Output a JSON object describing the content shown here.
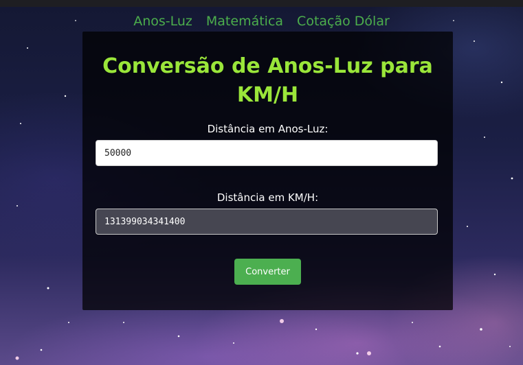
{
  "nav": {
    "items": [
      {
        "label": "Anos-Luz"
      },
      {
        "label": "Matemática"
      },
      {
        "label": "Cotação Dólar"
      }
    ]
  },
  "converter": {
    "title": "Conversão de Anos-Luz para KM/H",
    "input_label": "Distância em Anos-Luz:",
    "input_value": "50000",
    "output_label": "Distância em KM/H:",
    "output_value": "131399034341400",
    "button_label": "Converter"
  },
  "colors": {
    "accent": "#9ae63a",
    "nav_link": "#4cae4c",
    "button": "#4caf50"
  }
}
